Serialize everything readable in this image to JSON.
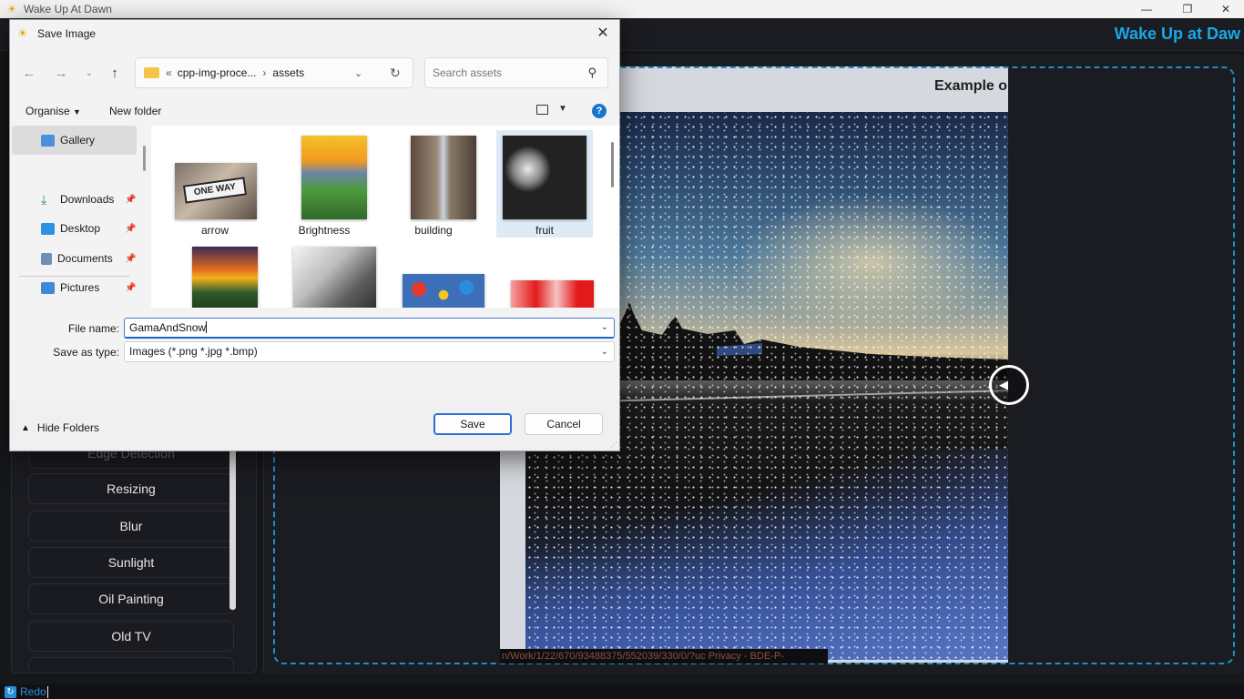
{
  "app": {
    "window_title": "Wake Up At Dawn",
    "brand": "Wake Up at Daw",
    "min_glyph": "—",
    "max_glyph": "❐",
    "close_glyph": "✕"
  },
  "sidebar": {
    "items": [
      {
        "label": "Edge Detection",
        "faded": true
      },
      {
        "label": "Resizing"
      },
      {
        "label": "Blur"
      },
      {
        "label": "Sunlight"
      },
      {
        "label": "Oil Painting"
      },
      {
        "label": "Old TV"
      }
    ]
  },
  "canvas": {
    "caption": "Example o",
    "status_url": "n/Work/1/22/670/93488375/552039/330/0/?uc Privacy - BDE-P-"
  },
  "statusbar": {
    "redo_label": "Redo"
  },
  "dialog": {
    "title": "Save Image",
    "address": {
      "prefix": "«",
      "parent": "cpp-img-proce...",
      "current": "assets"
    },
    "search_placeholder": "Search assets",
    "commands": {
      "organise": "Organise",
      "new_folder": "New folder"
    },
    "nav": {
      "gallery": "Gallery",
      "items": [
        "Downloads",
        "Desktop",
        "Documents",
        "Pictures"
      ]
    },
    "files": [
      {
        "name": "arrow",
        "selected": false
      },
      {
        "name": "Brightness",
        "selected": false
      },
      {
        "name": "building",
        "selected": false
      },
      {
        "name": "fruit",
        "selected": true
      }
    ],
    "file_name_label": "File name:",
    "file_name_value": "GamaAndSnow",
    "save_type_label": "Save as type:",
    "save_type_value": "Images (*.png *.jpg *.bmp)",
    "hide_folders": "Hide Folders",
    "save_button": "Save",
    "cancel_button": "Cancel"
  },
  "colors": {
    "accent": "#18a8e8",
    "drop_zone_border": "#1d8fc9",
    "dialog_primary": "#2a6fd6"
  }
}
